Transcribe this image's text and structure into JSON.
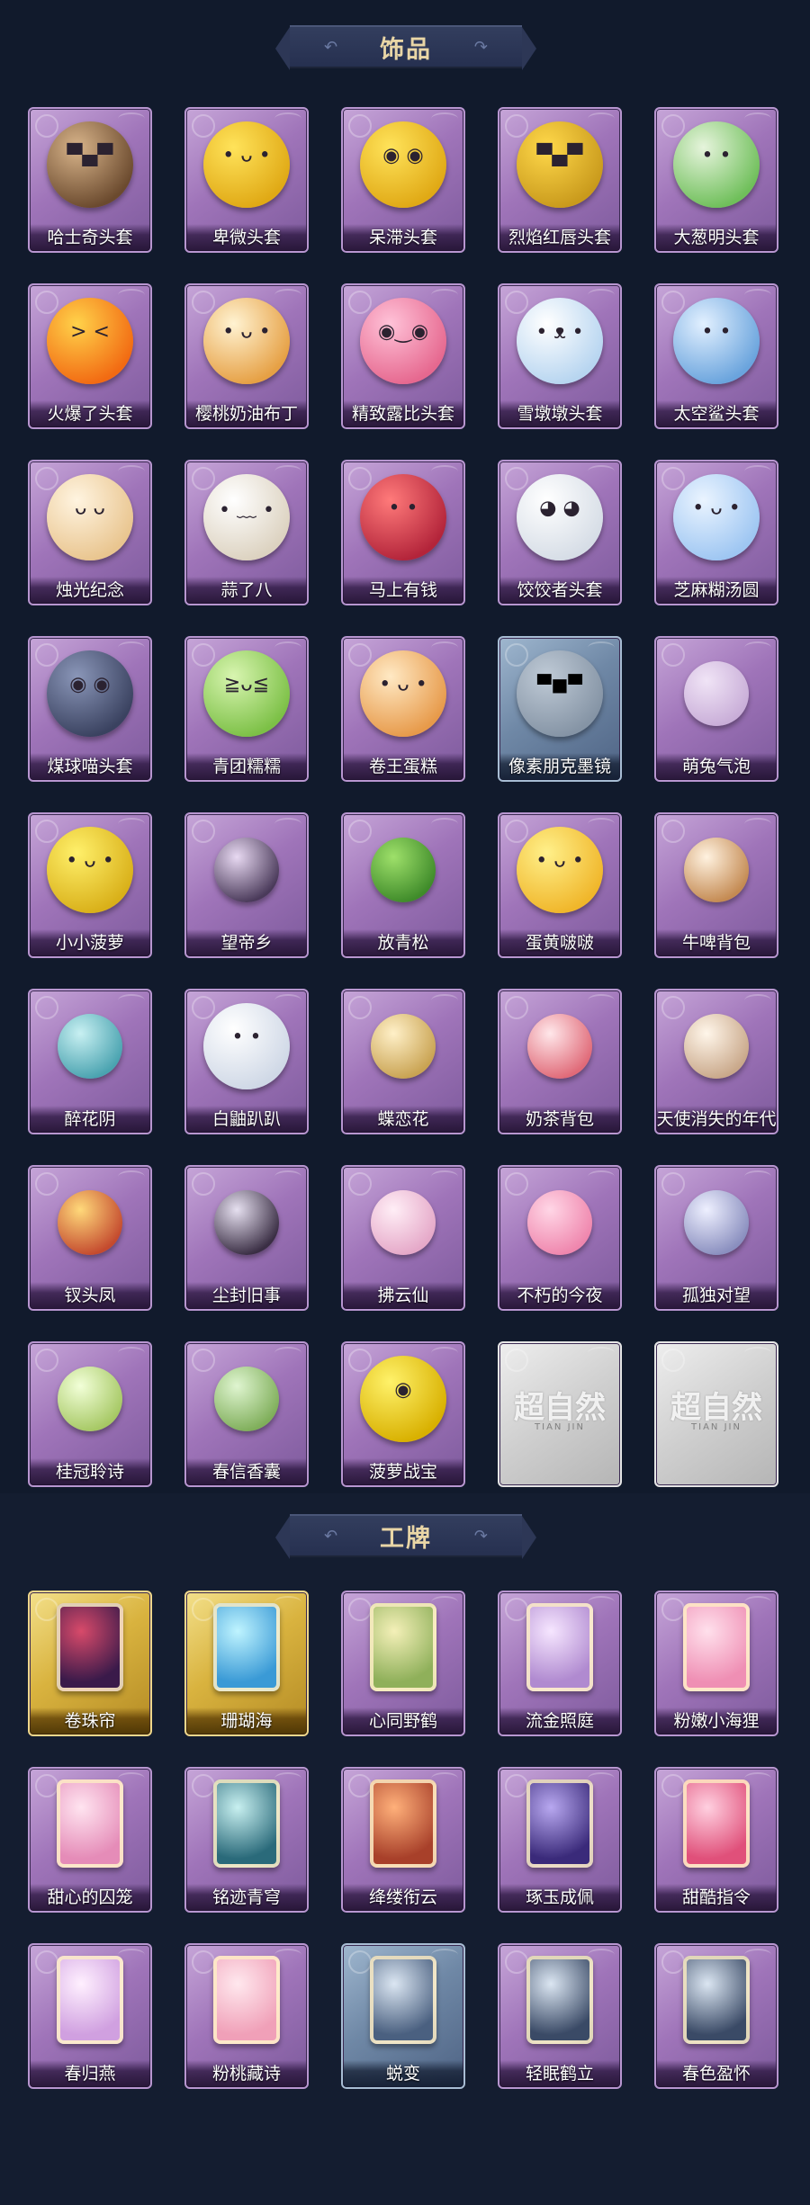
{
  "sections": {
    "accessories": {
      "title": "饰品",
      "items": [
        {
          "label": "哈士奇头套",
          "icon": "husky-head-icon",
          "face": "▀▄▀",
          "c1": "#d8b48a",
          "c2": "#6b4a2e"
        },
        {
          "label": "卑微头套",
          "icon": "humble-face-icon",
          "face": "• ᴗ •",
          "c1": "#ffe35a",
          "c2": "#e0a915"
        },
        {
          "label": "呆滞头套",
          "icon": "dazed-face-icon",
          "face": "◉ ◉",
          "c1": "#ffe35a",
          "c2": "#e0a915"
        },
        {
          "label": "烈焰红唇头套",
          "icon": "red-lips-head-icon",
          "face": "▀▄▀",
          "c1": "#ffd84a",
          "c2": "#c99a1c"
        },
        {
          "label": "大葱明头套",
          "icon": "scallion-head-icon",
          "face": "• •",
          "c1": "#e6f4dc",
          "c2": "#6fbf5a"
        },
        {
          "label": "火爆了头套",
          "icon": "fire-head-icon",
          "face": "> <",
          "c1": "#ffd24a",
          "c2": "#f26a12"
        },
        {
          "label": "樱桃奶油布丁",
          "icon": "cherry-pudding-icon",
          "face": "• ᴗ •",
          "c1": "#fff3d2",
          "c2": "#e6a044"
        },
        {
          "label": "精致露比头套",
          "icon": "ruby-head-icon",
          "face": "◉‿◉",
          "c1": "#ffc2d8",
          "c2": "#e6688f"
        },
        {
          "label": "雪墩墩头套",
          "icon": "snowman-head-icon",
          "face": "• ᴥ •",
          "c1": "#ffffff",
          "c2": "#b7d5f0"
        },
        {
          "label": "太空鲨头套",
          "icon": "space-shark-icon",
          "face": "• •",
          "c1": "#e2f0ff",
          "c2": "#6aa4dd"
        },
        {
          "label": "烛光纪念",
          "icon": "candle-icon",
          "face": "ᴗ ᴗ",
          "c1": "#fff4e0",
          "c2": "#e9c58f"
        },
        {
          "label": "蒜了八",
          "icon": "garlic-icon",
          "face": "• ﹏ •",
          "c1": "#ffffff",
          "c2": "#dcd2c0"
        },
        {
          "label": "马上有钱",
          "icon": "horse-icon",
          "face": "• •",
          "c1": "#ff7a7a",
          "c2": "#b3243a"
        },
        {
          "label": "饺饺者头套",
          "icon": "dumpling-head-icon",
          "face": "◕ ◕",
          "c1": "#ffffff",
          "c2": "#d6dde6"
        },
        {
          "label": "芝麻糊汤圆",
          "icon": "tangyuan-icon",
          "face": "• ᴗ •",
          "c1": "#eaf4ff",
          "c2": "#9ec6f2"
        },
        {
          "label": "煤球喵头套",
          "icon": "black-cat-head-icon",
          "face": "◉ ◉",
          "c1": "#8a96b8",
          "c2": "#3a4260"
        },
        {
          "label": "青团糯糯",
          "icon": "green-rice-ball-icon",
          "face": "≧ᴗ≦",
          "c1": "#d8f5b0",
          "c2": "#7cc046"
        },
        {
          "label": "卷王蛋糕",
          "icon": "roll-cake-icon",
          "face": "• ᴗ •",
          "c1": "#ffe9c4",
          "c2": "#e79a4a"
        },
        {
          "label": "像素朋克墨镜",
          "icon": "pixel-sunglasses-icon",
          "face": "▀■▀",
          "c1": "#bfcad6",
          "c2": "#8594a5"
        },
        {
          "label": "萌兔气泡",
          "icon": "rabbit-bubble-icon",
          "face": "",
          "c1": "#f0e4f6",
          "c2": "#c9aed8"
        },
        {
          "label": "小小菠萝",
          "icon": "pineapple-icon",
          "face": "• ᴗ •",
          "c1": "#fff06a",
          "c2": "#d9b019"
        },
        {
          "label": "望帝乡",
          "icon": "figure-icon",
          "face": "",
          "c1": "#e8d9f2",
          "c2": "#4a3a5a"
        },
        {
          "label": "放青松",
          "icon": "pine-bonsai-icon",
          "face": "",
          "c1": "#9ee06a",
          "c2": "#3f8b2a"
        },
        {
          "label": "蛋黄啵啵",
          "icon": "yolk-chick-icon",
          "face": "• ᴗ •",
          "c1": "#fff08a",
          "c2": "#f0b62a"
        },
        {
          "label": "牛啤背包",
          "icon": "cow-beer-backpack-icon",
          "face": "",
          "c1": "#fff2e0",
          "c2": "#c48a52"
        },
        {
          "label": "醉花阴",
          "icon": "flower-pendant-icon",
          "face": "",
          "c1": "#c8f0f2",
          "c2": "#4aa3b0"
        },
        {
          "label": "白鼬趴趴",
          "icon": "ferret-icon",
          "face": "• •",
          "c1": "#ffffff",
          "c2": "#cfd8e6"
        },
        {
          "label": "蝶恋花",
          "icon": "butterfly-pendant-icon",
          "face": "",
          "c1": "#fff0c8",
          "c2": "#c9a352"
        },
        {
          "label": "奶茶背包",
          "icon": "milk-tea-backpack-icon",
          "face": "",
          "c1": "#ffe7ea",
          "c2": "#e06a78"
        },
        {
          "label": "天使消失的年代",
          "icon": "angel-figure-icon",
          "face": "",
          "c1": "#fff6ea",
          "c2": "#c9a88a"
        },
        {
          "label": "钗头凤",
          "icon": "phoenix-crown-icon",
          "face": "",
          "c1": "#ffd97a",
          "c2": "#c44a2e"
        },
        {
          "label": "尘封旧事",
          "icon": "figure-pendant-icon",
          "face": "",
          "c1": "#e6e0f0",
          "c2": "#3a2e44"
        },
        {
          "label": "拂云仙",
          "icon": "fairy-pendant-icon",
          "face": "",
          "c1": "#ffeef6",
          "c2": "#e5a8c8"
        },
        {
          "label": "不朽的今夜",
          "icon": "cake-pendant-icon",
          "face": "",
          "c1": "#ffd6e6",
          "c2": "#ef86ad"
        },
        {
          "label": "孤独对望",
          "icon": "doll-pendant-icon",
          "face": "",
          "c1": "#eef0ff",
          "c2": "#8a8fbf"
        },
        {
          "label": "桂冠聆诗",
          "icon": "laurel-pendant-icon",
          "face": "",
          "c1": "#f2ffd8",
          "c2": "#a6c864"
        },
        {
          "label": "春信香囊",
          "icon": "sachet-icon",
          "face": "",
          "c1": "#dff5d0",
          "c2": "#7fae5a"
        },
        {
          "label": "菠萝战宝",
          "icon": "pineapple-warrior-icon",
          "face": "◉",
          "c1": "#fff26a",
          "c2": "#d8b000"
        },
        {
          "label": "",
          "icon": "locked-placeholder-icon",
          "face": "",
          "c1": "#ffffff",
          "c2": "#cccccc",
          "placeholder": "超自然",
          "placeholder_sub": "TIAN JIN"
        },
        {
          "label": "",
          "icon": "locked-placeholder-icon",
          "face": "",
          "c1": "#ffffff",
          "c2": "#cccccc",
          "placeholder": "超自然",
          "placeholder_sub": "TIAN JIN"
        }
      ]
    },
    "badges": {
      "title": "工牌",
      "items": [
        {
          "label": "卷珠帘",
          "icon": "badge-frame-icon",
          "c1": "#d84a6a",
          "c2": "#3a1a4a",
          "tier": "gold"
        },
        {
          "label": "珊瑚海",
          "icon": "badge-frame-icon",
          "c1": "#bff4ff",
          "c2": "#3a9ad6",
          "tier": "gold"
        },
        {
          "label": "心同野鹤",
          "icon": "badge-frame-icon",
          "c1": "#f4f0b8",
          "c2": "#8fb05a",
          "tier": "purple"
        },
        {
          "label": "流金照庭",
          "icon": "badge-frame-icon",
          "c1": "#f6e6ff",
          "c2": "#b08ad0",
          "tier": "purple"
        },
        {
          "label": "粉嫩小海狸",
          "icon": "badge-frame-icon",
          "c1": "#ffe0ec",
          "c2": "#ef8fb4",
          "tier": "purple"
        },
        {
          "label": "甜心的囚笼",
          "icon": "badge-frame-icon",
          "c1": "#ffe4f0",
          "c2": "#e58cb8",
          "tier": "purple"
        },
        {
          "label": "铭迹青穹",
          "icon": "badge-frame-icon",
          "c1": "#c8f0f0",
          "c2": "#2a6a7a",
          "tier": "purple"
        },
        {
          "label": "绛缕衔云",
          "icon": "badge-frame-icon",
          "c1": "#ffb07a",
          "c2": "#a8402a",
          "tier": "purple"
        },
        {
          "label": "琢玉成佩",
          "icon": "badge-frame-icon",
          "c1": "#b8a8f0",
          "c2": "#3a2a7a",
          "tier": "purple"
        },
        {
          "label": "甜酷指令",
          "icon": "badge-frame-icon",
          "c1": "#ffd0e0",
          "c2": "#e0507a",
          "tier": "purple"
        },
        {
          "label": "春归燕",
          "icon": "badge-frame-icon",
          "c1": "#fff0ff",
          "c2": "#d0a0e0",
          "tier": "purple"
        },
        {
          "label": "粉桃藏诗",
          "icon": "badge-frame-icon",
          "c1": "#ffe8ee",
          "c2": "#f0a0b8",
          "tier": "purple"
        },
        {
          "label": "蜕变",
          "icon": "silhouette-badge-icon",
          "c1": "#dbe6f2",
          "c2": "#4a6080",
          "tier": "blue"
        },
        {
          "label": "轻眠鹤立",
          "icon": "silhouette-badge-icon",
          "c1": "#dbe6f2",
          "c2": "#3a4a66",
          "tier": "purple"
        },
        {
          "label": "春色盈怀",
          "icon": "silhouette-badge-icon",
          "c1": "#dbe6f2",
          "c2": "#3a4a66",
          "tier": "purple"
        }
      ]
    }
  },
  "ornaments": {
    "swirl_left": "↶",
    "swirl_right": "↷"
  }
}
